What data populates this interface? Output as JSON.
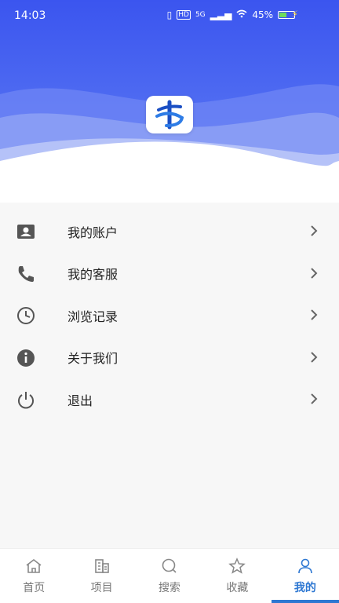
{
  "status_bar": {
    "time": "14:03",
    "network": "5G",
    "hd": "HD",
    "battery_percent": "45%",
    "battery_level": 0.45
  },
  "profile": {
    "app_logo": "app-logo-icon",
    "header_gradient": [
      "#3b5bf0",
      "#9fb0f7"
    ]
  },
  "menu": {
    "items": [
      {
        "label": "我的账户",
        "icon": "account-card-icon"
      },
      {
        "label": "我的客服",
        "icon": "phone-icon"
      },
      {
        "label": "浏览记录",
        "icon": "clock-icon"
      },
      {
        "label": "关于我们",
        "icon": "info-icon"
      },
      {
        "label": "退出",
        "icon": "power-icon"
      }
    ]
  },
  "tabbar": {
    "tabs": [
      {
        "label": "首页",
        "icon": "home-icon"
      },
      {
        "label": "项目",
        "icon": "building-icon"
      },
      {
        "label": "搜索",
        "icon": "search-icon"
      },
      {
        "label": "收藏",
        "icon": "star-icon"
      },
      {
        "label": "我的",
        "icon": "user-icon",
        "active": true
      }
    ],
    "active_color": "#2d77d2"
  }
}
